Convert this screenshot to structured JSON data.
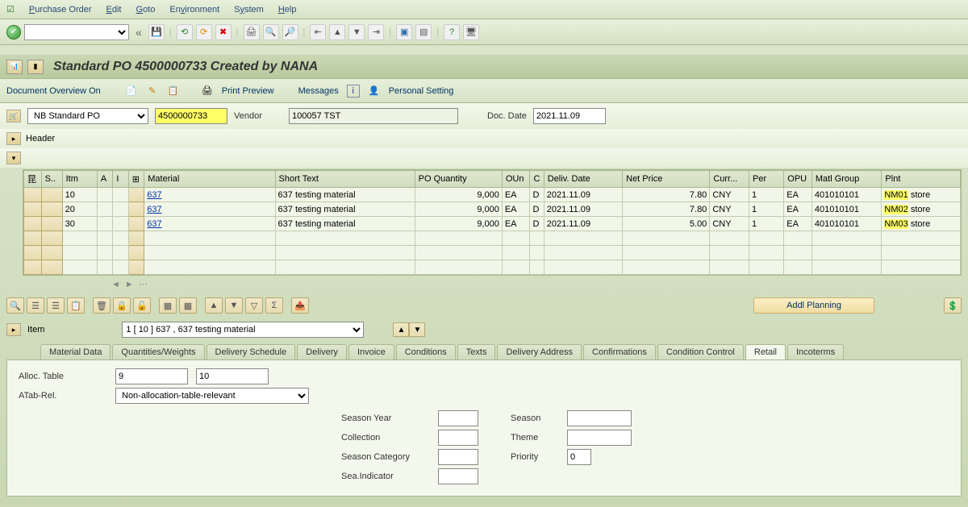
{
  "menu": {
    "items": [
      "Purchase Order",
      "Edit",
      "Goto",
      "Environment",
      "System",
      "Help"
    ]
  },
  "title": "Standard PO 4500000733 Created by NANA",
  "toolbar2": {
    "doc_overview": "Document Overview On",
    "print_preview": "Print Preview",
    "messages": "Messages",
    "personal_setting": "Personal Setting"
  },
  "doc": {
    "type": "NB Standard PO",
    "number": "4500000733",
    "vendor_label": "Vendor",
    "vendor_value": "100057 TST",
    "date_label": "Doc. Date",
    "date_value": "2021.11.09"
  },
  "header_label": "Header",
  "grid": {
    "cols": [
      "",
      "S..",
      "Itm",
      "A",
      "I",
      "",
      "Material",
      "Short Text",
      "PO Quantity",
      "OUn",
      "C",
      "Deliv. Date",
      "Net Price",
      "Curr...",
      "Per",
      "OPU",
      "Matl Group",
      "Plnt"
    ],
    "rows": [
      {
        "itm": "10",
        "mat": "637",
        "stext": "637 testing material",
        "qty": "9,000",
        "oun": "EA",
        "c": "D",
        "deliv": "2021.11.09",
        "price": "7.80",
        "curr": "CNY",
        "per": "1",
        "opu": "EA",
        "mg": "401010101",
        "plnt": "NM01",
        "plnt_name": "store"
      },
      {
        "itm": "20",
        "mat": "637",
        "stext": "637 testing material",
        "qty": "9,000",
        "oun": "EA",
        "c": "D",
        "deliv": "2021.11.09",
        "price": "7.80",
        "curr": "CNY",
        "per": "1",
        "opu": "EA",
        "mg": "401010101",
        "plnt": "NM02",
        "plnt_name": "store"
      },
      {
        "itm": "30",
        "mat": "637",
        "stext": "637 testing material",
        "qty": "9,000",
        "oun": "EA",
        "c": "D",
        "deliv": "2021.11.09",
        "price": "5.00",
        "curr": "CNY",
        "per": "1",
        "opu": "EA",
        "mg": "401010101",
        "plnt": "NM03",
        "plnt_name": "store"
      }
    ]
  },
  "addl_planning": "Addl Planning",
  "item_label": "Item",
  "item_select": "1 [ 10 ] 637 , 637 testing material",
  "tabs": [
    "Material Data",
    "Quantities/Weights",
    "Delivery Schedule",
    "Delivery",
    "Invoice",
    "Conditions",
    "Texts",
    "Delivery Address",
    "Confirmations",
    "Condition Control",
    "Retail",
    "Incoterms"
  ],
  "active_tab": "Retail",
  "retail": {
    "alloc_label": "Alloc. Table",
    "alloc_v1": "9",
    "alloc_v2": "10",
    "atab_label": "ATab-Rel.",
    "atab_value": "Non-allocation-table-relevant",
    "season_year": "Season Year",
    "collection": "Collection",
    "season_cat": "Season Category",
    "sea_ind": "Sea.Indicator",
    "season": "Season",
    "theme": "Theme",
    "priority": "Priority",
    "priority_v": "0"
  }
}
